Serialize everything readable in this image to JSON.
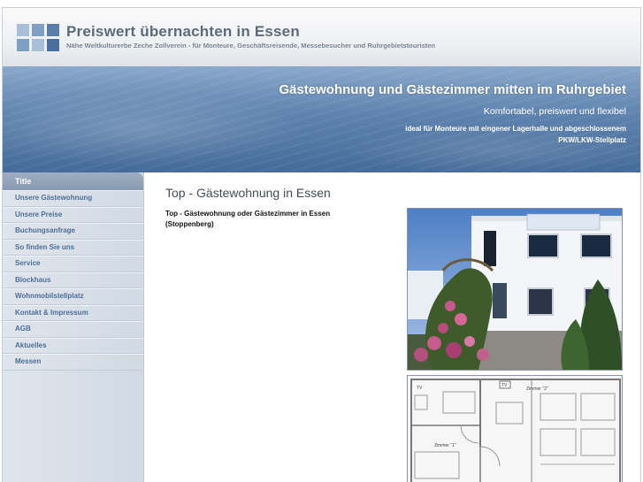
{
  "header": {
    "title": "Preiswert übernachten in Essen",
    "subtitle": "Nähe Weltkulturerbe Zeche Zollverein - für Monteure, Geschäftsreisende, Messebesucher und Ruhrgebietstouristen"
  },
  "banner": {
    "headline": "Gästewohnung und Gästezimmer mitten im Ruhrgebiet",
    "tagline": "Komfortabel, preiswert und flexibel",
    "note": "ideal für Monteure mit eingener Lagerhalle und abgeschlossenem PKW/LKW-Stellplatz"
  },
  "sidebar": {
    "title": "Title",
    "items": [
      {
        "label": "Unsere Gästewohnung"
      },
      {
        "label": "Unsere Preise"
      },
      {
        "label": "Buchungsanfrage"
      },
      {
        "label": "So finden Sie uns"
      },
      {
        "label": "Service"
      },
      {
        "label": "Blockhaus"
      },
      {
        "label": "Wohnmobilstellplatz"
      },
      {
        "label": "Kontakt & Impressum"
      },
      {
        "label": "AGB"
      },
      {
        "label": "Aktuelles"
      },
      {
        "label": "Messen"
      }
    ]
  },
  "main": {
    "page_title": "Top - Gästewohnung in Essen",
    "intro": "Top - Gästewohnung oder Gästezimmer in Essen (Stoppenberg)",
    "plan_labels": {
      "tv_1": "TV",
      "tv_2": "TV",
      "zimmer_2": "Zimmer \"2\"",
      "zimmer_1": "Zimmer \"1\""
    }
  },
  "colors": {
    "nav_text": "#4e6e98",
    "banner_blue": "#5e83ae",
    "title_gray": "#5c6a7c"
  }
}
